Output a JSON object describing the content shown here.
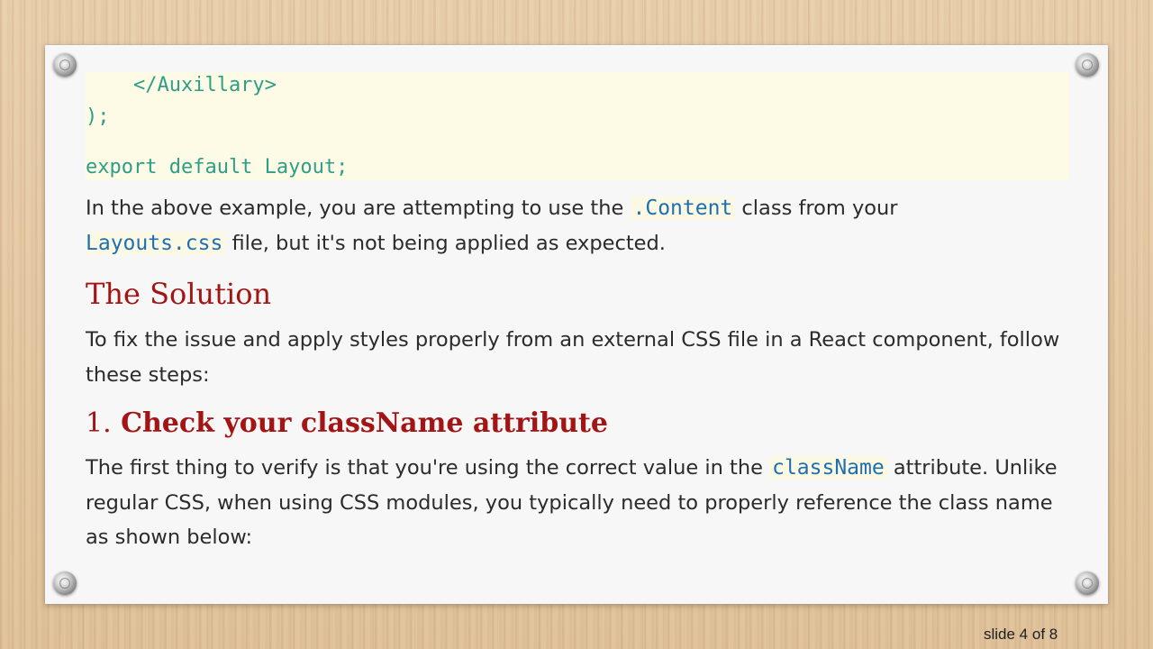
{
  "code": {
    "line1": "    </Auxillary>",
    "line2": ");",
    "line3": "export default Layout;"
  },
  "paragraph1": {
    "part1": "In the above example, you are attempting to use the ",
    "code1": ".Content",
    "part2": " class from your",
    "code2": "Layouts.css",
    "part3": " file, but it's not being applied as expected."
  },
  "heading_solution": "The Solution",
  "paragraph2": "To fix the issue and apply styles properly from an external CSS file in a React component, follow these steps:",
  "heading_step1": {
    "number": "1.",
    "text": "Check your className attribute"
  },
  "paragraph3": {
    "part1": "The first thing to verify is that you're using the correct value in the ",
    "code1": "className",
    "part2": " attribute. Unlike regular CSS, when using CSS modules, you typically need to properly reference the class name as shown below:"
  },
  "slide_indicator": "slide 4 of 8",
  "colors": {
    "heading": "#a31515",
    "code_text": "#2e9e86",
    "inline_code": "#1f6fb0",
    "code_background": "#fdfbe6"
  }
}
